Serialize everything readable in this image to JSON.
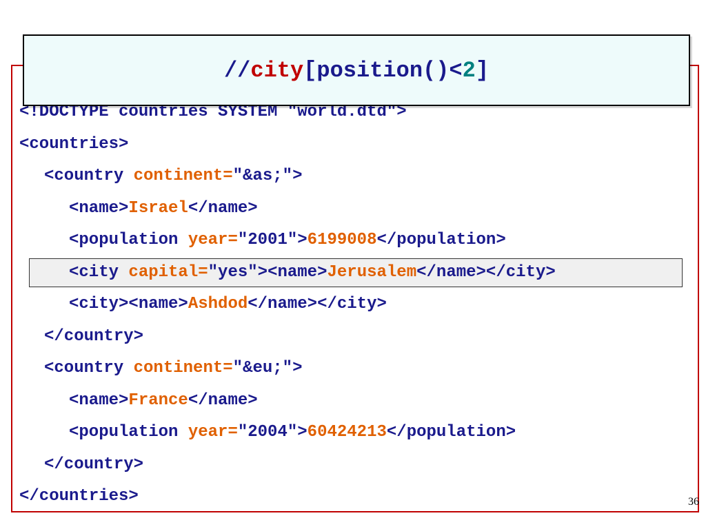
{
  "title": {
    "prefix": "//",
    "element": "city",
    "predicate_open": "[position()<",
    "number": "2",
    "predicate_close": "]"
  },
  "code_lines": [
    {
      "indent": 0,
      "segments": [
        {
          "text": "<!DOCTYPE countries SYSTEM \"world.dtd\">",
          "kind": "tag"
        }
      ]
    },
    {
      "indent": 0,
      "segments": [
        {
          "text": "<countries>",
          "kind": "tag"
        }
      ]
    },
    {
      "indent": 1,
      "segments": [
        {
          "text": "<country ",
          "kind": "tag"
        },
        {
          "text": "continent=",
          "kind": "attr"
        },
        {
          "text": "\"&as;\">",
          "kind": "tag"
        }
      ]
    },
    {
      "indent": 2,
      "segments": [
        {
          "text": "<name>",
          "kind": "tag"
        },
        {
          "text": "Israel",
          "kind": "value"
        },
        {
          "text": "</name>",
          "kind": "tag"
        }
      ]
    },
    {
      "indent": 2,
      "segments": [
        {
          "text": "<population ",
          "kind": "tag"
        },
        {
          "text": "year=",
          "kind": "attr"
        },
        {
          "text": "\"2001\">",
          "kind": "tag"
        },
        {
          "text": "6199008",
          "kind": "value"
        },
        {
          "text": "</population>",
          "kind": "tag"
        }
      ]
    },
    {
      "indent": 2,
      "highlighted": true,
      "segments": [
        {
          "text": "<city ",
          "kind": "tag"
        },
        {
          "text": "capital=",
          "kind": "attr"
        },
        {
          "text": "\"yes\">",
          "kind": "tag"
        },
        {
          "text": "<name>",
          "kind": "tag"
        },
        {
          "text": "Jerusalem",
          "kind": "value"
        },
        {
          "text": "</name></city>",
          "kind": "tag"
        }
      ]
    },
    {
      "indent": 2,
      "segments": [
        {
          "text": "<city><name>",
          "kind": "tag"
        },
        {
          "text": "Ashdod",
          "kind": "value"
        },
        {
          "text": "</name></city>",
          "kind": "tag"
        }
      ]
    },
    {
      "indent": 1,
      "segments": [
        {
          "text": "</country>",
          "kind": "tag"
        }
      ]
    },
    {
      "indent": 1,
      "segments": [
        {
          "text": "<country ",
          "kind": "tag"
        },
        {
          "text": "continent=",
          "kind": "attr"
        },
        {
          "text": "\"&eu;\">",
          "kind": "tag"
        }
      ]
    },
    {
      "indent": 2,
      "segments": [
        {
          "text": "<name>",
          "kind": "tag"
        },
        {
          "text": "France",
          "kind": "value"
        },
        {
          "text": "</name>",
          "kind": "tag"
        }
      ]
    },
    {
      "indent": 2,
      "segments": [
        {
          "text": "<population ",
          "kind": "tag"
        },
        {
          "text": "year=",
          "kind": "attr"
        },
        {
          "text": "\"2004\">",
          "kind": "tag"
        },
        {
          "text": "60424213",
          "kind": "value"
        },
        {
          "text": "</population>",
          "kind": "tag"
        }
      ]
    },
    {
      "indent": 1,
      "segments": [
        {
          "text": "</country>",
          "kind": "tag"
        }
      ]
    },
    {
      "indent": 0,
      "segments": [
        {
          "text": "</countries>",
          "kind": "tag"
        }
      ]
    }
  ],
  "slide_number": "36",
  "colors": {
    "tag": "#1a1a8c",
    "attr": "#e06000",
    "value": "#e06000",
    "title_keyword": "#c00000",
    "title_number": "#008080",
    "frame_border": "#c00000",
    "title_background": "#eefbfb",
    "highlight_background": "#f0f0f0"
  }
}
